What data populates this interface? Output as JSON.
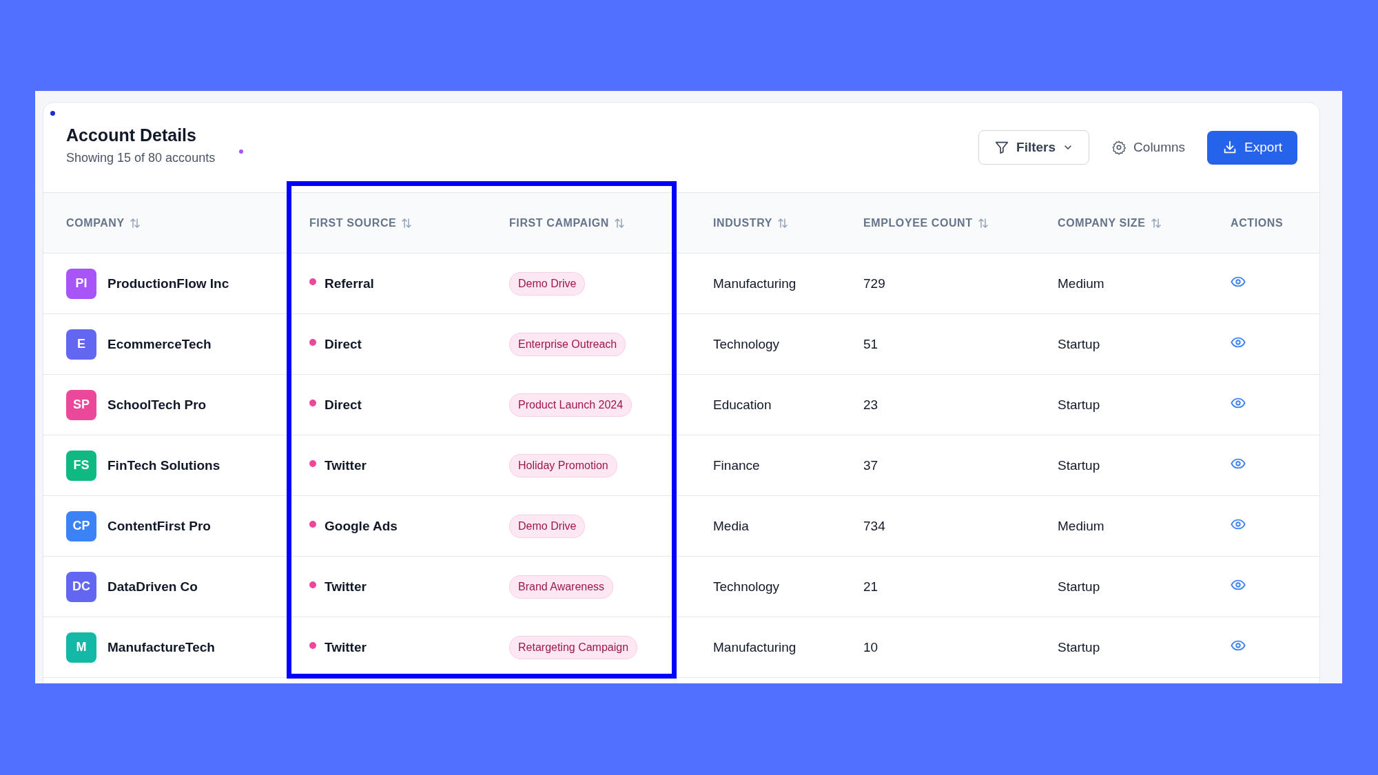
{
  "header": {
    "title": "Account Details",
    "subtitle": "Showing 15 of 80 accounts"
  },
  "toolbar": {
    "filters": "Filters",
    "columns": "Columns",
    "export": "Export"
  },
  "table": {
    "columns": [
      {
        "label": "COMPANY",
        "sortable": true,
        "highlighted": false
      },
      {
        "label": "FIRST SOURCE",
        "sortable": true,
        "highlighted": true
      },
      {
        "label": "FIRST CAMPAIGN",
        "sortable": true,
        "highlighted": true
      },
      {
        "label": "INDUSTRY",
        "sortable": true,
        "highlighted": false
      },
      {
        "label": "EMPLOYEE COUNT",
        "sortable": true,
        "highlighted": false
      },
      {
        "label": "COMPANY SIZE",
        "sortable": true,
        "highlighted": false
      },
      {
        "label": "ACTIONS",
        "sortable": false,
        "highlighted": false
      }
    ],
    "rows": [
      {
        "initials": "PI",
        "color": "#a855f7",
        "company": "ProductionFlow Inc",
        "first_source": "Referral",
        "first_campaign": "Demo Drive",
        "industry": "Manufacturing",
        "employee_count": "729",
        "company_size": "Medium"
      },
      {
        "initials": "E",
        "color": "#6366f1",
        "company": "EcommerceTech",
        "first_source": "Direct",
        "first_campaign": "Enterprise Outreach",
        "industry": "Technology",
        "employee_count": "51",
        "company_size": "Startup"
      },
      {
        "initials": "SP",
        "color": "#ec4899",
        "company": "SchoolTech Pro",
        "first_source": "Direct",
        "first_campaign": "Product Launch 2024",
        "industry": "Education",
        "employee_count": "23",
        "company_size": "Startup"
      },
      {
        "initials": "FS",
        "color": "#10b981",
        "company": "FinTech Solutions",
        "first_source": "Twitter",
        "first_campaign": "Holiday Promotion",
        "industry": "Finance",
        "employee_count": "37",
        "company_size": "Startup"
      },
      {
        "initials": "CP",
        "color": "#3b82f6",
        "company": "ContentFirst Pro",
        "first_source": "Google Ads",
        "first_campaign": "Demo Drive",
        "industry": "Media",
        "employee_count": "734",
        "company_size": "Medium"
      },
      {
        "initials": "DC",
        "color": "#6366f1",
        "company": "DataDriven Co",
        "first_source": "Twitter",
        "first_campaign": "Brand Awareness",
        "industry": "Technology",
        "employee_count": "21",
        "company_size": "Startup"
      },
      {
        "initials": "M",
        "color": "#14b8a6",
        "company": "ManufactureTech",
        "first_source": "Twitter",
        "first_campaign": "Retargeting Campaign",
        "industry": "Manufacturing",
        "employee_count": "10",
        "company_size": "Startup"
      }
    ]
  }
}
